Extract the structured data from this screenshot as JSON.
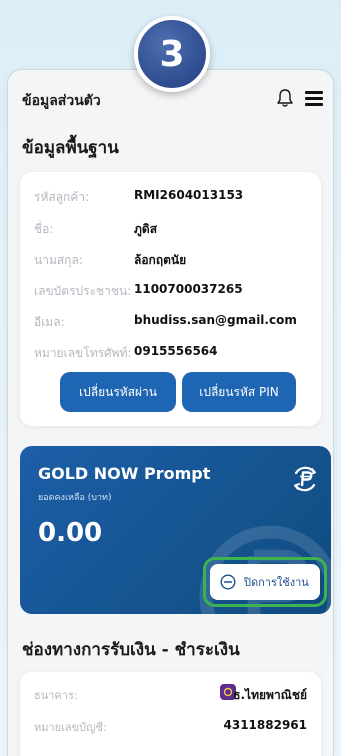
{
  "step_badge": "3",
  "header": {
    "title": "ข้อมูลส่วนตัว",
    "icons": [
      "bell-icon",
      "hamburger-menu-icon"
    ]
  },
  "basic_info": {
    "section_title": "ข้อมูลพื้นฐาน",
    "rows": [
      {
        "label": "รหัสลูกค้า:",
        "value": "RMI2604013153"
      },
      {
        "label": "ชื่อ:",
        "value": "ภูดิส"
      },
      {
        "label": "นามสกุล:",
        "value": "ล้อกฤตนัย"
      },
      {
        "label": "เลขบัตรประชาชน:",
        "value": "1100700037265"
      },
      {
        "label": "อีเมล:",
        "value": "bhudiss.san@gmail.com"
      },
      {
        "label": "หมายเลขโทรศัพท์:",
        "value": "0915556564"
      }
    ],
    "change_password_label": "เปลี่ยนรหัสผ่าน",
    "change_pin_label": "เปลี่ยนรหัส PIN"
  },
  "gold_card": {
    "name": "GOLD NOW Prompt",
    "balance_label": "ยอดคงเหลือ (บาท)",
    "balance": "0.00",
    "disable_label": "ปิดการใช้งาน"
  },
  "payment": {
    "section_title": "ช่องทางการรับเงิน - ชำระเงิน",
    "bank_label": "ธนาคาร:",
    "bank_value": "ธ.ไทยพาณิชย์",
    "account_label": "หมายเลขบัญชี:",
    "account_value": "4311882961"
  },
  "colors": {
    "primary_blue": "#1e66b3",
    "highlight_green": "#3cb34f",
    "bank_purple": "#5e2c8a"
  }
}
